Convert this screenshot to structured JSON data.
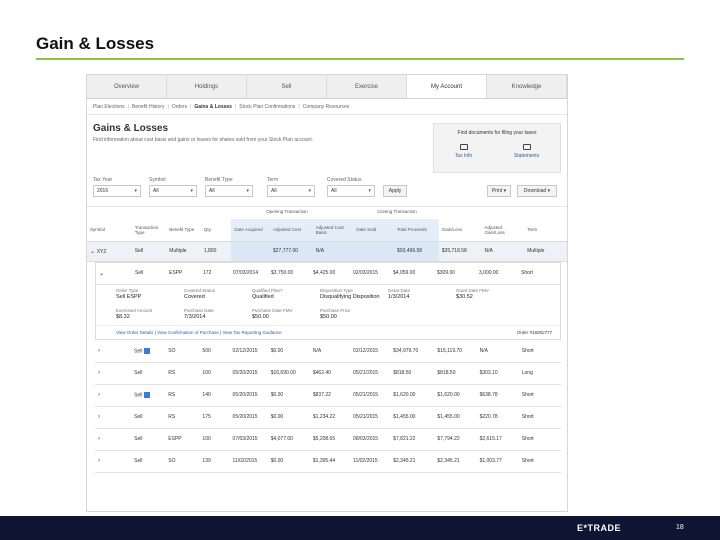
{
  "slide": {
    "title": "Gain & Losses",
    "page_number": "18",
    "logo_text": "E*TRADE"
  },
  "tabs": [
    "Overview",
    "Holdings",
    "Sell",
    "Exercise",
    "My Account",
    "Knowledge"
  ],
  "active_tab": "My Account",
  "subnav": [
    "Plan Elections",
    "Benefit History",
    "Orders",
    "Gains & Losses",
    "Stock Plan Confirmations",
    "Company Resources"
  ],
  "page": {
    "title": "Gains & Losses",
    "description": "Find information about cost basis and gains or losses for shares sold from your Stock Plan account."
  },
  "docs": {
    "title": "Find documents for filing your taxes",
    "links": [
      {
        "label": "Tax Info",
        "icon": "tray-icon"
      },
      {
        "label": "Statements",
        "icon": "tray-icon"
      }
    ]
  },
  "filters": {
    "tax_year": {
      "label": "Tax Year",
      "value": "2016"
    },
    "symbol": {
      "label": "Symbol",
      "value": "All"
    },
    "benefit_type": {
      "label": "Benefit Type",
      "value": "All"
    },
    "term": {
      "label": "Term",
      "value": "All"
    },
    "covered_status": {
      "label": "Covered Status",
      "value": "All"
    },
    "apply_label": "Apply",
    "print_label": "Print",
    "download_label": "Download"
  },
  "table": {
    "group_opening": "Opening Transaction",
    "group_closing": "Closing Transaction",
    "columns": [
      "Symbol",
      "Transaction Type",
      "Benefit Type",
      "Qty.",
      "Date Acquired",
      "Adjusted Cost",
      "Adjusted Cost Basis",
      "Date Sold",
      "Total Proceeds",
      "Gain/Loss",
      "Adjusted Gain/Loss",
      "Term"
    ],
    "summary": {
      "symbol": "XYZ",
      "txn": "Sell",
      "benefit": "Multiple",
      "qty": "1,800",
      "acq": "",
      "cost": "$27,777.00",
      "basis": "N/A",
      "sold": "",
      "proceeds": "$93,496.58",
      "gain": "$35,718.58",
      "adj": "N/A",
      "term": "Multiple"
    },
    "first_lot": {
      "txn": "Sell",
      "benefit": "ESPP",
      "qty": "172",
      "acq": "07/03/2014",
      "cost": "$3,750.00",
      "basis": "$4,425.00",
      "sold": "02/03/2015",
      "proceeds": "$4,059.00",
      "gain": "$309.00",
      "adj": "3,000.00",
      "term": "Short"
    },
    "details": [
      {
        "label": "Order Type",
        "value": "Sell ESPP"
      },
      {
        "label": "Covered Status",
        "value": "Covered"
      },
      {
        "label": "Qualified Plan?",
        "value": "Qualified"
      },
      {
        "label": "Disposition Type",
        "value": "Disqualifying Disposition"
      },
      {
        "label": "Grant Date",
        "value": "1/3/2014"
      },
      {
        "label": "Grant Date FMV",
        "value": "$30.52"
      }
    ],
    "details2": [
      {
        "label": "Exercised Amount",
        "value": "$8.32"
      },
      {
        "label": "Purchase Date",
        "value": "7/3/2014"
      },
      {
        "label": "Purchase Date FMV",
        "value": "$50.00"
      },
      {
        "label": "Purchase Price",
        "value": "$50.00"
      }
    ],
    "detail_links": "View Order Details  |  View Confirmation of Purchase  |  View Tax Reporting Guidance",
    "order_number": "Order #16952777",
    "lots": [
      {
        "txn": "Sell",
        "badge": true,
        "benefit": "SO",
        "qty": "500",
        "acq": "02/12/2015",
        "cost": "$0.00",
        "basis": "N/A",
        "sold": "02/12/2015",
        "proceeds": "$34,979.70",
        "gain": "$15,119.70",
        "adj": "N/A",
        "term": "Short"
      },
      {
        "txn": "Sell",
        "badge": false,
        "benefit": "RS",
        "qty": "100",
        "acq": "05/20/2015",
        "cost": "$16,690.00",
        "basis": "$462.40",
        "sold": "05/21/2015",
        "proceeds": "$818.50",
        "gain": "$818.50",
        "adj": "$303.10",
        "term": "Long"
      },
      {
        "txn": "Sell",
        "badge": true,
        "benefit": "RS",
        "qty": "140",
        "acq": "05/20/2015",
        "cost": "$0.00",
        "basis": "$837.22",
        "sold": "05/21/2015",
        "proceeds": "$1,620.00",
        "gain": "$1,620.00",
        "adj": "$638.78",
        "term": "Short"
      },
      {
        "txn": "Sell",
        "badge": false,
        "benefit": "RS",
        "qty": "175",
        "acq": "05/20/2015",
        "cost": "$0.00",
        "basis": "$1,234.22",
        "sold": "05/21/2015",
        "proceeds": "$1,455.00",
        "gain": "$1,455.00",
        "adj": "$220.78",
        "term": "Short"
      },
      {
        "txn": "Sell",
        "badge": false,
        "benefit": "ESPP",
        "qty": "100",
        "acq": "07/03/2015",
        "cost": "$4,077.00",
        "basis": "$5,208.65",
        "sold": "08/03/2015",
        "proceeds": "$7,821.22",
        "gain": "$7,794.22",
        "adj": "$2,615.17",
        "term": "Short"
      },
      {
        "txn": "Sell",
        "badge": false,
        "benefit": "SO",
        "qty": "139",
        "acq": "11/02/2015",
        "cost": "$0.00",
        "basis": "$1,395.44",
        "sold": "11/02/2015",
        "proceeds": "$2,345.21",
        "gain": "$2,345.21",
        "adj": "$1,003.77",
        "term": "Short"
      }
    ]
  }
}
